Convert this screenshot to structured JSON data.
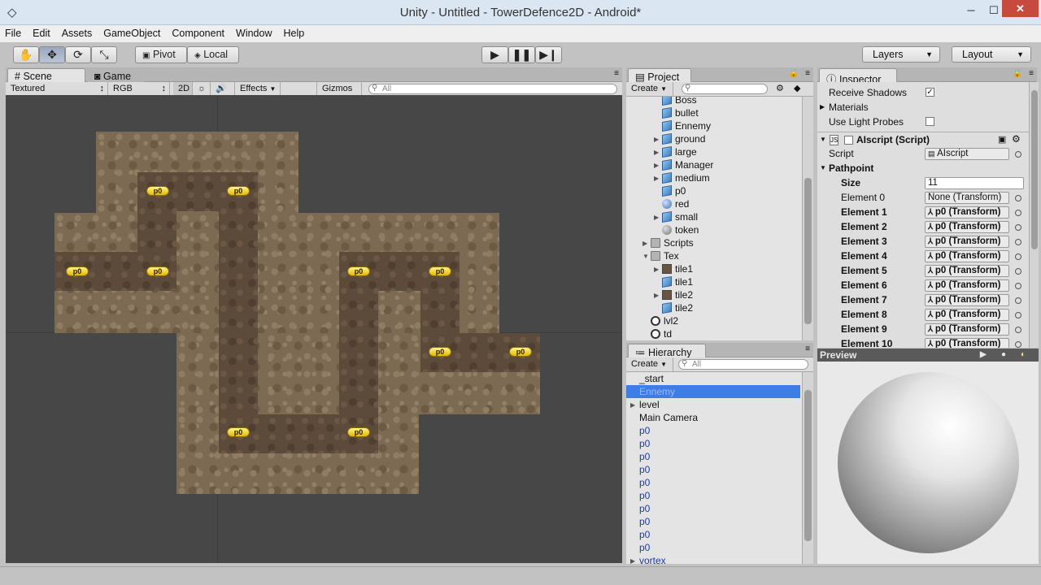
{
  "window": {
    "title": "Unity - Untitled - TowerDefence2D - Android*",
    "minimize": "─",
    "maximize": "☐",
    "close": "✕"
  },
  "menu": [
    "File",
    "Edit",
    "Assets",
    "GameObject",
    "Component",
    "Window",
    "Help"
  ],
  "toolbar": {
    "pivot": "Pivot",
    "local": "Local",
    "layers": "Layers",
    "layout": "Layout"
  },
  "scene_panel": {
    "tab_scene": "Scene",
    "tab_game": "Game",
    "render_mode": "Textured",
    "color_mode": "RGB",
    "mode_2d": "2D",
    "effects": "Effects",
    "gizmos": "Gizmos",
    "search_placeholder": "All",
    "waypoint_label": "p0"
  },
  "project_panel": {
    "tab": "Project",
    "create": "Create",
    "items": [
      {
        "label": "Boss",
        "icon": "prefab-cube-icon",
        "expand": false
      },
      {
        "label": "bullet",
        "icon": "prefab-cube-icon",
        "expand": false
      },
      {
        "label": "Ennemy",
        "icon": "prefab-cube-icon",
        "expand": false
      },
      {
        "label": "ground",
        "icon": "prefab-cube-icon",
        "expand": true
      },
      {
        "label": "large",
        "icon": "prefab-cube-icon",
        "expand": true
      },
      {
        "label": "Manager",
        "icon": "prefab-cube-icon",
        "expand": true
      },
      {
        "label": "medium",
        "icon": "prefab-cube-icon",
        "expand": true
      },
      {
        "label": "p0",
        "icon": "prefab-cube-icon",
        "expand": false
      },
      {
        "label": "red",
        "icon": "material-sphere-icon",
        "expand": false
      },
      {
        "label": "small",
        "icon": "prefab-cube-icon",
        "expand": true
      },
      {
        "label": "token",
        "icon": "grey-sphere-icon",
        "expand": false
      },
      {
        "label": "Scripts",
        "icon": "folder-icon",
        "expand": true
      },
      {
        "label": "Tex",
        "icon": "folder-icon",
        "expand": true
      },
      {
        "label": "tile1",
        "icon": "texture-icon",
        "expand": true
      },
      {
        "label": "tile1",
        "icon": "prefab-cube-icon",
        "expand": false
      },
      {
        "label": "tile2",
        "icon": "texture-icon",
        "expand": true
      },
      {
        "label": "tile2",
        "icon": "prefab-cube-icon",
        "expand": false
      },
      {
        "label": "lvl2",
        "icon": "unity-scene-icon",
        "expand": false
      },
      {
        "label": "td",
        "icon": "unity-scene-icon",
        "expand": false
      }
    ]
  },
  "hierarchy_panel": {
    "tab": "Hierarchy",
    "create": "Create",
    "search_placeholder": "All",
    "items": [
      "_start",
      "Ennemy",
      "level",
      "Main Camera",
      "p0",
      "p0",
      "p0",
      "p0",
      "p0",
      "p0",
      "p0",
      "p0",
      "p0",
      "p0",
      "vortex"
    ],
    "selected": "Ennemy"
  },
  "inspector": {
    "tab": "Inspector",
    "receive_shadows": "Receive Shadows",
    "receive_shadows_checked": "✓",
    "materials": "Materials",
    "use_light_probes": "Use Light Probes",
    "component_title": "AIscript (Script)",
    "script_label": "Script",
    "script_value": "AIscript",
    "pathpoint_label": "Pathpoint",
    "size_label": "Size",
    "size_value": "11",
    "elements": [
      {
        "label": "Element 0",
        "value": "None (Transform)"
      },
      {
        "label": "Element 1",
        "value": "p0 (Transform)"
      },
      {
        "label": "Element 2",
        "value": "p0 (Transform)"
      },
      {
        "label": "Element 3",
        "value": "p0 (Transform)"
      },
      {
        "label": "Element 4",
        "value": "p0 (Transform)"
      },
      {
        "label": "Element 5",
        "value": "p0 (Transform)"
      },
      {
        "label": "Element 6",
        "value": "p0 (Transform)"
      },
      {
        "label": "Element 7",
        "value": "p0 (Transform)"
      },
      {
        "label": "Element 8",
        "value": "p0 (Transform)"
      },
      {
        "label": "Element 9",
        "value": "p0 (Transform)"
      },
      {
        "label": "Element 10",
        "value": "p0 (Transform)"
      }
    ]
  },
  "preview": {
    "label": "Preview"
  }
}
